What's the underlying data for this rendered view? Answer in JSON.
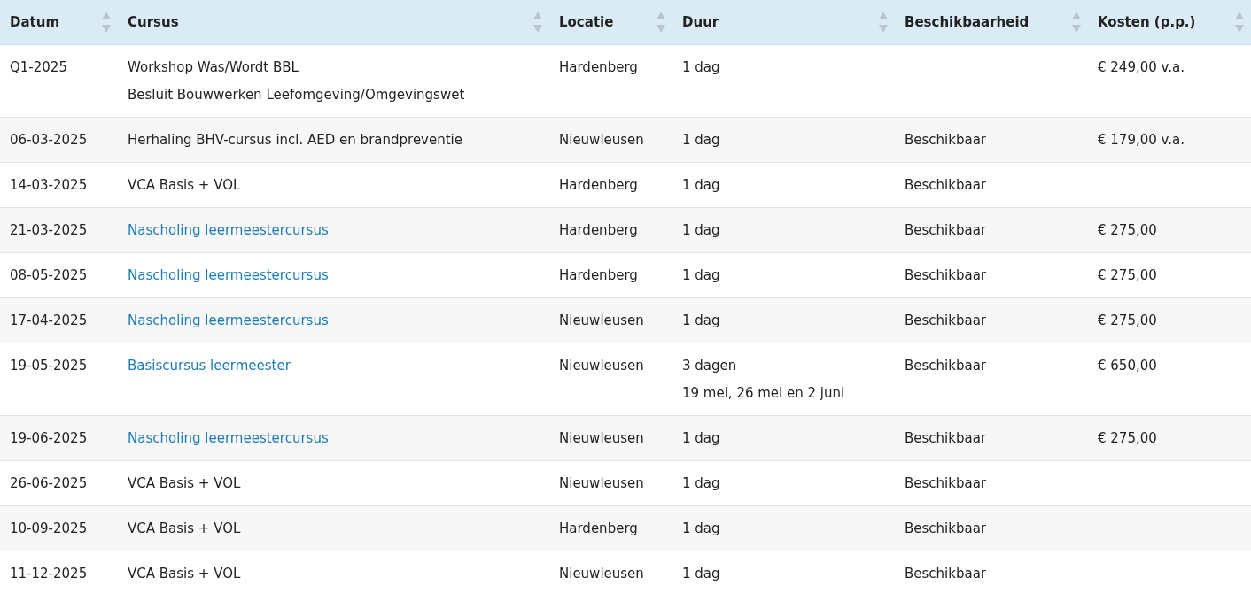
{
  "table": {
    "columns": [
      "Datum",
      "Cursus",
      "Locatie",
      "Duur",
      "Beschikbaarheid",
      "Kosten (p.p.)"
    ],
    "rows": [
      {
        "date": "Q1-2025",
        "course": "Workshop Was/Wordt BBL",
        "course_link": false,
        "course_note": "Besluit Bouwwerken Leefomgeving/Omgevingswet",
        "location": "Hardenberg",
        "duration": "1 dag",
        "cost": "€ 249,00 v.a."
      },
      {
        "date": "06-03-2025",
        "course": "Herhaling BHV-cursus incl. AED en brandpreventie",
        "course_link": false,
        "location": "Nieuwleusen",
        "duration": "1 dag",
        "availability": "Beschikbaar",
        "cost": "€ 179,00 v.a."
      },
      {
        "date": "14-03-2025",
        "course": "VCA Basis + VOL",
        "course_link": false,
        "location": "Hardenberg",
        "duration": "1 dag",
        "availability": "Beschikbaar"
      },
      {
        "date": "21-03-2025",
        "course": "Nascholing leermeestercursus",
        "course_link": true,
        "location": "Hardenberg",
        "duration": "1 dag",
        "availability": "Beschikbaar",
        "cost": "€ 275,00"
      },
      {
        "date": "08-05-2025",
        "course": "Nascholing leermeestercursus",
        "course_link": true,
        "location": "Hardenberg",
        "duration": "1 dag",
        "availability": "Beschikbaar",
        "cost": "€ 275,00"
      },
      {
        "date": "17-04-2025",
        "course": "Nascholing leermeestercursus",
        "course_link": true,
        "location": "Nieuwleusen",
        "duration": "1 dag",
        "availability": "Beschikbaar",
        "cost": "€ 275,00"
      },
      {
        "date": "19-05-2025",
        "course": "Basiscursus leermeester",
        "course_link": true,
        "location": "Nieuwleusen",
        "duration": "3 dagen",
        "duration_note": "19 mei, 26 mei en 2 juni",
        "availability": "Beschikbaar",
        "cost": "€ 650,00"
      },
      {
        "date": "19-06-2025",
        "course": "Nascholing leermeestercursus",
        "course_link": true,
        "location": "Nieuwleusen",
        "duration": "1 dag",
        "availability": "Beschikbaar",
        "cost": "€ 275,00"
      },
      {
        "date": "26-06-2025",
        "course": "VCA Basis + VOL",
        "course_link": false,
        "location": "Nieuwleusen",
        "duration": "1 dag",
        "availability": "Beschikbaar"
      },
      {
        "date": "10-09-2025",
        "course": "VCA Basis + VOL",
        "course_link": false,
        "location": "Hardenberg",
        "duration": "1 dag",
        "availability": "Beschikbaar"
      },
      {
        "date": "11-12-2025",
        "course": "VCA Basis + VOL",
        "course_link": false,
        "location": "Nieuwleusen",
        "duration": "1 dag",
        "availability": "Beschikbaar"
      }
    ]
  }
}
